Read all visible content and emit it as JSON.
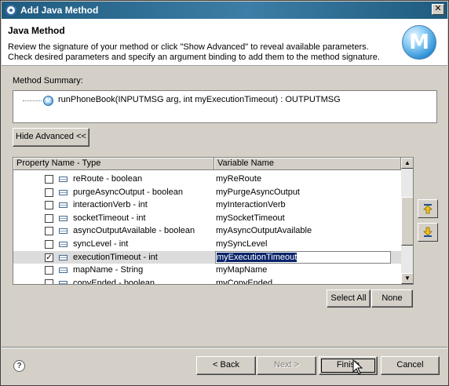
{
  "window": {
    "title": "Add Java Method",
    "close_glyph": "✕"
  },
  "banner": {
    "title": "Java Method",
    "description": "Review the signature of your method or click \"Show Advanced\" to reveal available parameters. Check desired parameters and specify an argument binding to add them to the method signature.",
    "logo_text": "M"
  },
  "summary": {
    "label": "Method Summary:",
    "icon_text": "M",
    "signature": "runPhoneBook(INPUTMSG arg, int myExecutionTimeout) : OUTPUTMSG"
  },
  "buttons": {
    "hide_advanced": "Hide Advanced <<",
    "select_all": "Select All",
    "none": "None",
    "back": "< Back",
    "next": "Next >",
    "finish": "Finish",
    "cancel": "Cancel"
  },
  "table": {
    "headers": {
      "property": "Property Name - Type",
      "variable": "Variable Name"
    },
    "rows": [
      {
        "property": "reRoute - boolean",
        "variable": "myReRoute",
        "checked": false
      },
      {
        "property": "purgeAsyncOutput - boolean",
        "variable": "myPurgeAsyncOutput",
        "checked": false
      },
      {
        "property": "interactionVerb - int",
        "variable": "myInteractionVerb",
        "checked": false
      },
      {
        "property": "socketTimeout - int",
        "variable": "mySocketTimeout",
        "checked": false
      },
      {
        "property": "asyncOutputAvailable - boolean",
        "variable": "myAsyncOutputAvailable",
        "checked": false
      },
      {
        "property": "syncLevel - int",
        "variable": "mySyncLevel",
        "checked": false
      },
      {
        "property": "executionTimeout - int",
        "variable": "myExecutionTimeout",
        "checked": true
      },
      {
        "property": "mapName - String",
        "variable": "myMapName",
        "checked": false
      },
      {
        "property": "copyEnded - boolean",
        "variable": "myCopyEnded",
        "checked": false
      }
    ],
    "check_glyph": "✓"
  },
  "help_glyph": "?"
}
